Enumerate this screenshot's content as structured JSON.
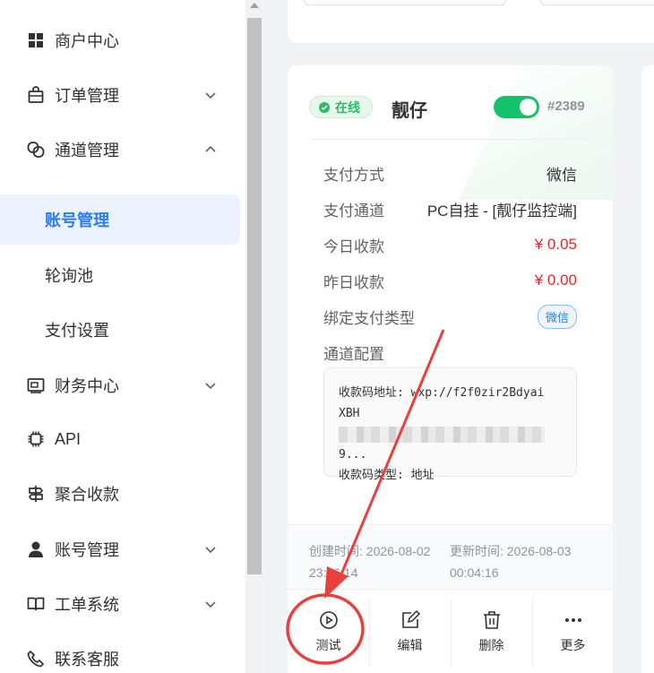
{
  "sidebar": {
    "items": [
      {
        "label": "商户中心",
        "icon": "grid-icon"
      },
      {
        "label": "订单管理",
        "icon": "bag-icon"
      },
      {
        "label": "通道管理",
        "icon": "link-icon"
      },
      {
        "label": "账号管理"
      },
      {
        "label": "轮询池"
      },
      {
        "label": "支付设置"
      },
      {
        "label": "财务中心",
        "icon": "finance-icon"
      },
      {
        "label": "API",
        "icon": "chip-icon"
      },
      {
        "label": "聚合收款",
        "icon": "signpost-icon"
      },
      {
        "label": "账号管理",
        "icon": "user-icon"
      },
      {
        "label": "工单系统",
        "icon": "book-icon"
      },
      {
        "label": "联系客服",
        "icon": "phone-icon"
      }
    ]
  },
  "card": {
    "status": "在线",
    "name": "靓仔",
    "enabled": true,
    "id": "#2389",
    "rows": [
      {
        "label": "支付方式",
        "value": "微信"
      },
      {
        "label": "支付通道",
        "value": "PC自挂 - [靓仔监控端]"
      },
      {
        "label": "今日收款",
        "value": "¥ 0.05"
      },
      {
        "label": "昨日收款",
        "value": "¥ 0.00"
      },
      {
        "label": "绑定支付类型",
        "value": "微信"
      }
    ],
    "config_label": "通道配置",
    "config": {
      "line1": "收款码地址: wxp://f2f0zir2Bdyai",
      "line2_prefix": "XBH",
      "line3": "9...",
      "line4": "收款码类型: 地址"
    },
    "created": "创建时间: 2026-08-02 23:56:14",
    "created_a": "创建时间: 2026-08-02",
    "created_b": "23:56:14",
    "updated_a": "更新时间: 2026-08-03",
    "updated_b": "00:04:16",
    "actions": [
      {
        "label": "测试",
        "icon": "play-icon"
      },
      {
        "label": "编辑",
        "icon": "edit-icon"
      },
      {
        "label": "删除",
        "icon": "trash-icon"
      },
      {
        "label": "更多",
        "icon": "more-icon"
      }
    ]
  },
  "colors": {
    "accent": "#2d7cf6",
    "online": "#2fb867",
    "toggle": "#13c26a",
    "money": "#e02b2b",
    "annotation": "#e8403f"
  }
}
